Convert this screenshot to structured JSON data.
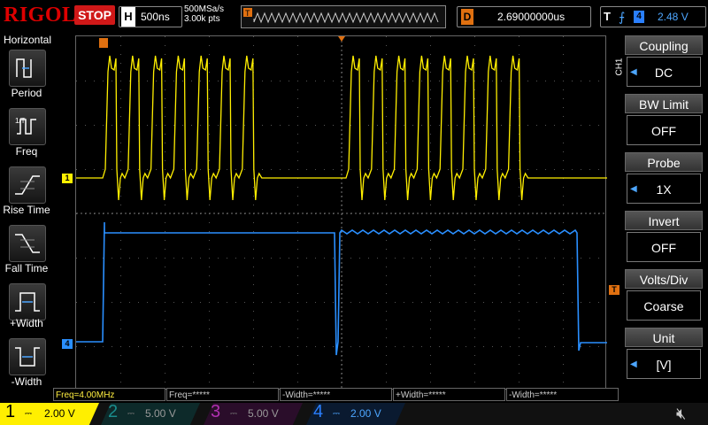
{
  "top": {
    "brand": "RIGOL",
    "run_state": "STOP",
    "timebase_label": "H",
    "timebase": "500ns",
    "sample_rate": "500MSa/s",
    "points": "3.00k pts",
    "delay_label": "D",
    "delay": "2.69000000us",
    "trigger_label": "T",
    "trigger_channel": "4",
    "trigger_level": "2.48 V"
  },
  "left_menu": {
    "title": "Horizontal",
    "items": [
      {
        "label": "Period",
        "icon": "period-icon"
      },
      {
        "label": "Freq",
        "icon": "freq-icon"
      },
      {
        "label": "Rise Time",
        "icon": "rise-time-icon"
      },
      {
        "label": "Fall Time",
        "icon": "fall-time-icon"
      },
      {
        "label": "+Width",
        "icon": "positive-width-icon"
      },
      {
        "label": "-Width",
        "icon": "negative-width-icon"
      }
    ]
  },
  "right_menu": {
    "channel_tag": "CH1",
    "items": [
      {
        "title": "Coupling",
        "value": "DC",
        "has_arrow": true
      },
      {
        "title": "BW Limit",
        "value": "OFF",
        "has_arrow": false
      },
      {
        "title": "Probe",
        "value": "1X",
        "has_arrow": true
      },
      {
        "title": "Invert",
        "value": "OFF",
        "has_arrow": false
      },
      {
        "title": "Volts/Div",
        "value": "Coarse",
        "has_arrow": false
      },
      {
        "title": "Unit",
        "value": "[V]",
        "has_arrow": true
      }
    ]
  },
  "measurements": [
    {
      "text": "Freq=4.00MHz",
      "active": true
    },
    {
      "text": "Freq=*****",
      "active": false
    },
    {
      "text": "-Width=*****",
      "active": false
    },
    {
      "text": "+Width=*****",
      "active": false
    },
    {
      "text": "-Width=*****",
      "active": false
    }
  ],
  "channels": [
    {
      "num": "1",
      "scale": "2.00 V",
      "color": "#ffef00"
    },
    {
      "num": "2",
      "scale": "5.00 V",
      "color": "#1a8c8c"
    },
    {
      "num": "3",
      "scale": "5.00 V",
      "color": "#b030b0"
    },
    {
      "num": "4",
      "scale": "2.00 V",
      "color": "#2a7fff"
    }
  ],
  "markers": {
    "ch1": "1",
    "ch4": "4",
    "trig_pos": "T"
  },
  "colors": {
    "ch1": "#ffef00",
    "ch4": "#2a8fff",
    "trigger": "#e07010",
    "stop": "#d01818"
  }
}
